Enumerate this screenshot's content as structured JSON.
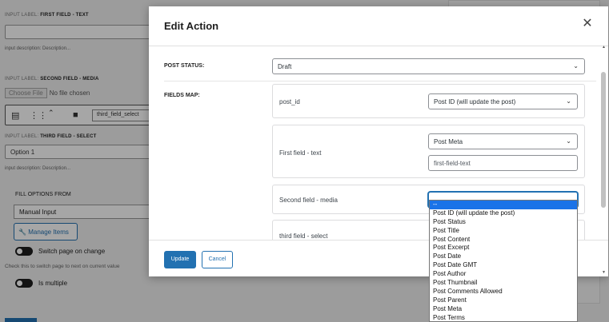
{
  "background": {
    "field1": {
      "label_prefix": "INPUT LABEL:",
      "label": "FIRST FIELD - TEXT",
      "description": "input description: Description..."
    },
    "field2": {
      "label_prefix": "INPUT LABEL:",
      "label": "SECOND FIELD - MEDIA",
      "choose_file": "Choose File",
      "no_file": "No file chosen",
      "toolbar_value": "third_field_select"
    },
    "field3": {
      "label_prefix": "INPUT LABEL:",
      "label": "THIRD FIELD - SELECT",
      "value": "Option 1",
      "description": "input description: Description..."
    },
    "fill_options_from": "FILL OPTIONS FROM",
    "fill_value": "Manual Input",
    "manage_items": "Manage Items",
    "switch_page": "Switch page on change",
    "switch_desc": "Check this to switch page to next on current value",
    "is_multiple": "Is multiple"
  },
  "modal": {
    "title": "Edit Action",
    "post_status_label": "POST STATUS:",
    "post_status_value": "Draft",
    "fields_map_label": "FIELDS MAP:",
    "rows": [
      {
        "label": "post_id",
        "select": "Post ID (will update the post)"
      },
      {
        "label": "First field - text",
        "select": "Post Meta",
        "input": "first-field-text"
      },
      {
        "label": "Second field - media",
        "select": "--"
      },
      {
        "label": "third field - select"
      }
    ],
    "update_button": "Update",
    "cancel_button": "Cancel"
  },
  "dropdown": {
    "options": [
      "--",
      "Post ID (will update the post)",
      "Post Status",
      "Post Title",
      "Post Content",
      "Post Excerpt",
      "Post Date",
      "Post Date GMT",
      "Post Author",
      "Post Thumbnail",
      "Post Comments Allowed",
      "Post Parent",
      "Post Meta",
      "Post Terms"
    ],
    "selected_index": 0
  },
  "colors": {
    "accent": "#2271b1",
    "selected": "#1a73e8"
  }
}
